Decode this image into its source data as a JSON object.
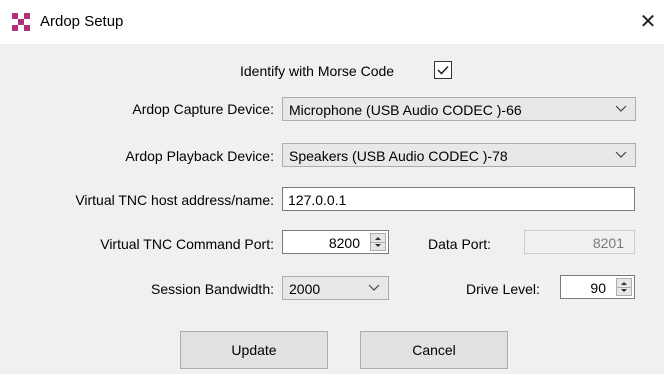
{
  "window": {
    "title": "Ardop Setup",
    "close_glyph": "✕"
  },
  "morse": {
    "label": "Identify with Morse Code",
    "checked": true
  },
  "capture": {
    "label": "Ardop Capture Device:",
    "value": "Microphone (USB Audio CODEC )-66"
  },
  "playback": {
    "label": "Ardop Playback Device:",
    "value": "Speakers (USB Audio CODEC )-78"
  },
  "host": {
    "label": "Virtual TNC host address/name:",
    "value": "127.0.0.1"
  },
  "command_port": {
    "label": "Virtual TNC Command Port:",
    "value": "8200"
  },
  "data_port": {
    "label": "Data Port:",
    "value": "8201"
  },
  "bandwidth": {
    "label": "Session Bandwidth:",
    "value": "2000"
  },
  "drive": {
    "label": "Drive Level:",
    "value": "90"
  },
  "buttons": {
    "update": "Update",
    "cancel": "Cancel"
  },
  "colors": {
    "icon_accent": "#b0307a",
    "window_bg": "#f0f0f0"
  }
}
